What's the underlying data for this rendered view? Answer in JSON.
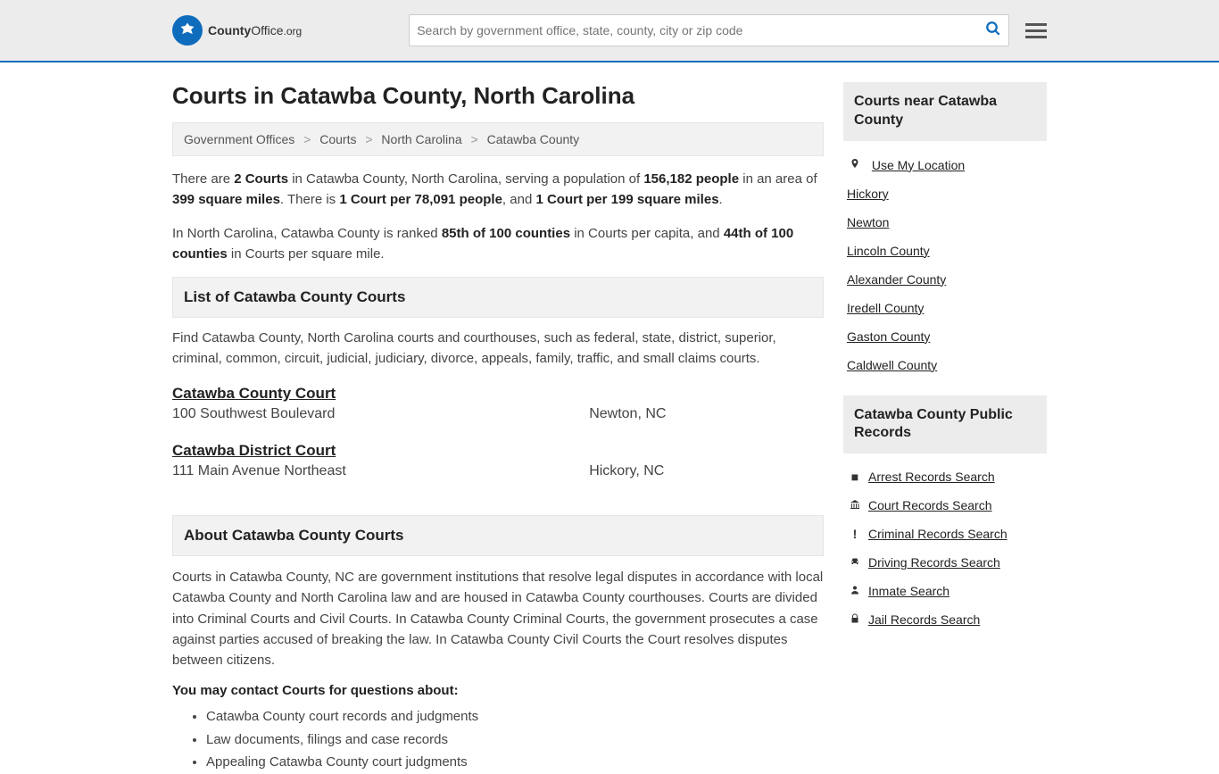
{
  "header": {
    "logo_bold": "County",
    "logo_thin": "Office",
    "logo_org": ".org",
    "search_placeholder": "Search by government office, state, county, city or zip code"
  },
  "page_title": "Courts in Catawba County, North Carolina",
  "breadcrumb": {
    "b0": "Government Offices",
    "b1": "Courts",
    "b2": "North Carolina",
    "b3": "Catawba County"
  },
  "intro": {
    "p1_pre": "There are ",
    "p1_s1": "2 Courts",
    "p1_mid1": " in Catawba County, North Carolina, serving a population of ",
    "p1_s2": "156,182 people",
    "p1_mid2": " in an area of ",
    "p1_s3": "399 square miles",
    "p1_mid3": ". There is ",
    "p1_s4": "1 Court per 78,091 people",
    "p1_mid4": ", and ",
    "p1_s5": "1 Court per 199 square miles",
    "p1_end": ".",
    "p2_pre": "In North Carolina, Catawba County is ranked ",
    "p2_s1": "85th of 100 counties",
    "p2_mid1": " in Courts per capita, and ",
    "p2_s2": "44th of 100 counties",
    "p2_end": " in Courts per square mile."
  },
  "list_section": {
    "heading": "List of Catawba County Courts",
    "desc": "Find Catawba County, North Carolina courts and courthouses, such as federal, state, district, superior, criminal, common, circuit, judicial, judiciary, divorce, appeals, family, traffic, and small claims courts."
  },
  "courts": {
    "c0": {
      "name": "Catawba County Court",
      "addr": "100 Southwest Boulevard",
      "city": "Newton, NC"
    },
    "c1": {
      "name": "Catawba District Court",
      "addr": "111 Main Avenue Northeast",
      "city": "Hickory, NC"
    }
  },
  "about": {
    "heading": "About Catawba County Courts",
    "text": "Courts in Catawba County, NC are government institutions that resolve legal disputes in accordance with local Catawba County and North Carolina law and are housed in Catawba County courthouses. Courts are divided into Criminal Courts and Civil Courts. In Catawba County Criminal Courts, the government prosecutes a case against parties accused of breaking the law. In Catawba County Civil Courts the Court resolves disputes between citizens.",
    "contact_lead": "You may contact Courts for questions about:",
    "q0": "Catawba County court records and judgments",
    "q1": "Law documents, filings and case records",
    "q2": "Appealing Catawba County court judgments"
  },
  "sidebar": {
    "near_heading": "Courts near Catawba County",
    "use_location": "Use My Location",
    "n0": "Hickory",
    "n1": "Newton",
    "n2": "Lincoln County",
    "n3": "Alexander County",
    "n4": "Iredell County",
    "n5": "Gaston County",
    "n6": "Caldwell County",
    "records_heading": "Catawba County Public Records",
    "r0": "Arrest Records Search",
    "r1": "Court Records Search",
    "r2": "Criminal Records Search",
    "r3": "Driving Records Search",
    "r4": "Inmate Search",
    "r5": "Jail Records Search"
  }
}
